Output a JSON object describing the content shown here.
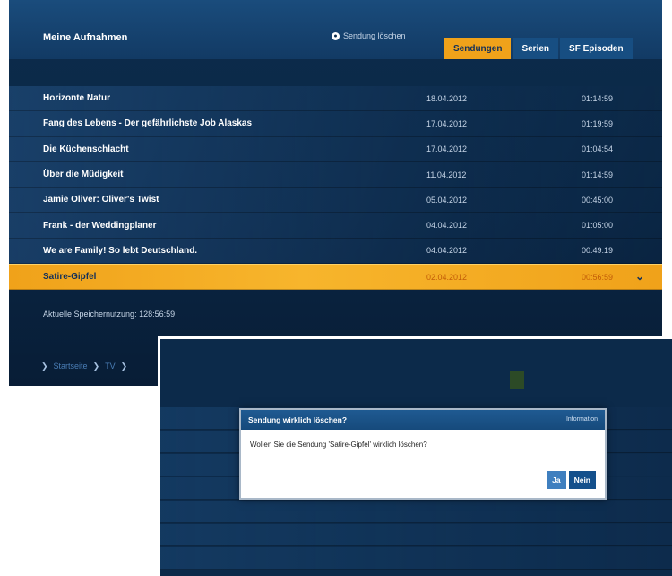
{
  "main": {
    "title": "Meine Aufnahmen",
    "delete_action_label": "Sendung löschen",
    "tabs": [
      {
        "label": "Sendungen",
        "active": true
      },
      {
        "label": "Serien",
        "active": false
      },
      {
        "label": "SF Episoden",
        "active": false
      }
    ],
    "recordings": [
      {
        "title": "Horizonte Natur",
        "date": "18.04.2012",
        "duration": "01:14:59"
      },
      {
        "title": "Fang des Lebens - Der gefährlichste Job Alaskas",
        "date": "17.04.2012",
        "duration": "01:19:59"
      },
      {
        "title": "Die Küchenschlacht",
        "date": "17.04.2012",
        "duration": "01:04:54"
      },
      {
        "title": "Über die Müdigkeit",
        "date": "11.04.2012",
        "duration": "01:14:59"
      },
      {
        "title": "Jamie Oliver: Oliver's Twist",
        "date": "05.04.2012",
        "duration": "00:45:00"
      },
      {
        "title": "Frank - der Weddingplaner",
        "date": "04.04.2012",
        "duration": "01:05:00"
      },
      {
        "title": "We are Family! So lebt Deutschland.",
        "date": "04.04.2012",
        "duration": "00:49:19"
      },
      {
        "title": "Satire-Gipfel",
        "date": "02.04.2012",
        "duration": "00:56:59",
        "selected": true
      }
    ],
    "storage_text": "Aktuelle Speichernutzung: 128:56:59",
    "breadcrumb": [
      "Startseite",
      "TV"
    ]
  },
  "dialog": {
    "title": "Sendung wirklich löschen?",
    "info_label": "Information",
    "message": "Wollen Sie die Sendung 'Satire-Gipfel' wirklich löschen?",
    "yes_label": "Ja",
    "no_label": "Nein"
  },
  "colors": {
    "accent": "#f0a21a",
    "background": "#0c2c4c",
    "header": "#164a7c"
  }
}
